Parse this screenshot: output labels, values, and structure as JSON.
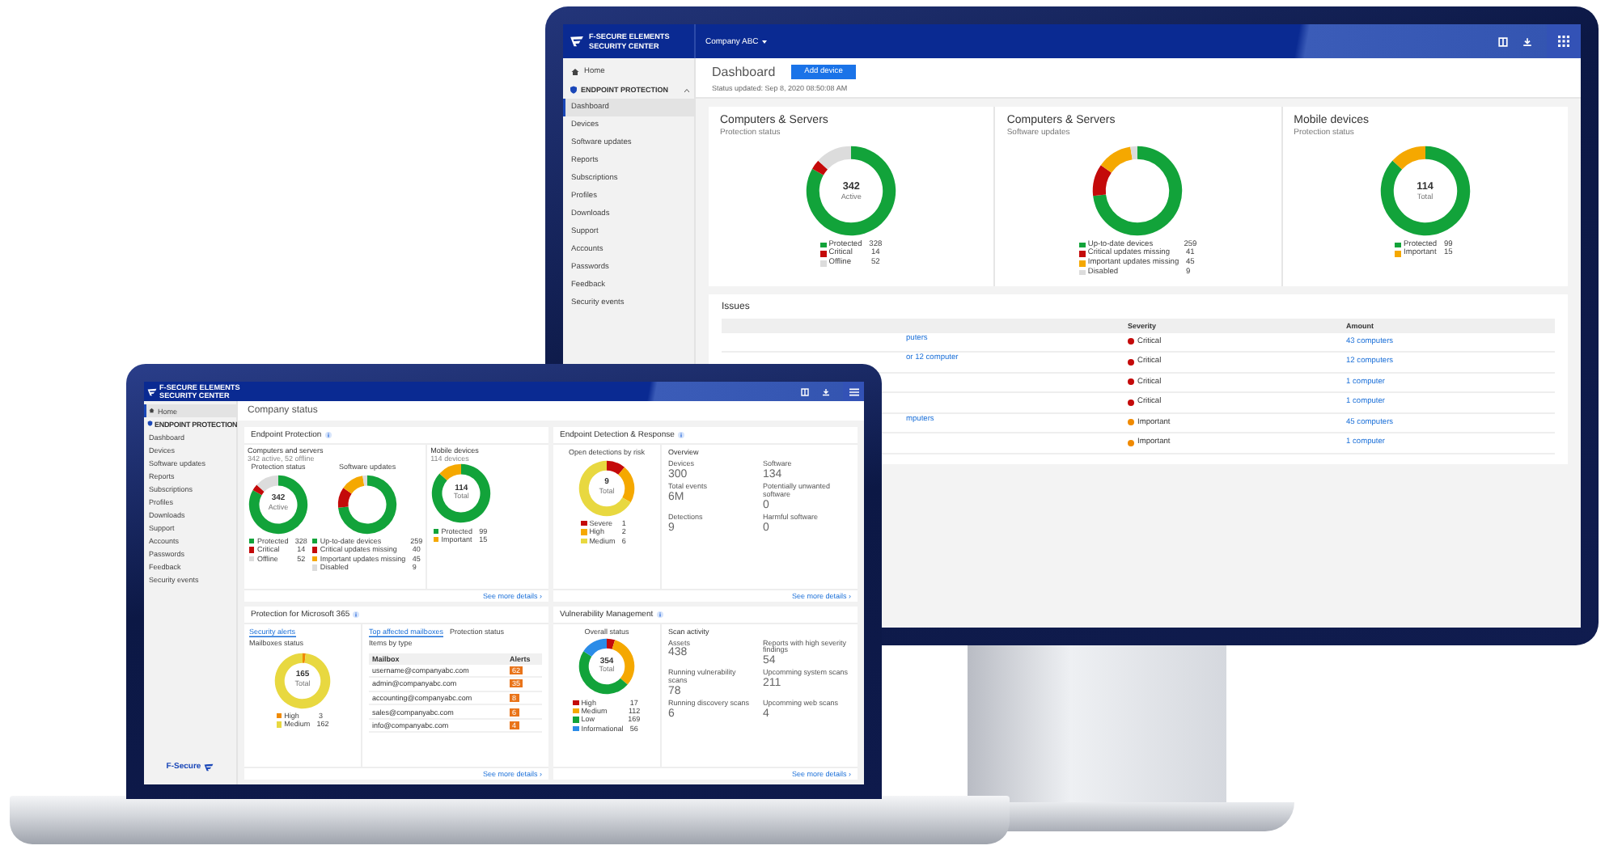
{
  "monitor": {
    "header": {
      "brand_line_1": "F-SECURE ELEMENTS",
      "brand_line_2": "SECURITY CENTER",
      "company": "Company ABC"
    },
    "sidebar": {
      "home": {
        "label": "Home",
        "selected": false
      },
      "section": "ENDPOINT PROTECTION",
      "items": [
        {
          "label": "Dashboard",
          "selected": true
        },
        {
          "label": "Devices",
          "selected": false
        },
        {
          "label": "Software updates",
          "selected": false
        },
        {
          "label": "Reports",
          "selected": false
        },
        {
          "label": "Subscriptions",
          "selected": false
        },
        {
          "label": "Profiles",
          "selected": false
        },
        {
          "label": "Downloads",
          "selected": false
        },
        {
          "label": "Support",
          "selected": false
        },
        {
          "label": "Accounts",
          "selected": false
        },
        {
          "label": "Passwords",
          "selected": false
        },
        {
          "label": "Feedback",
          "selected": false
        },
        {
          "label": "Security events",
          "selected": false
        }
      ]
    },
    "page": {
      "title": "Dashboard",
      "button": "Add device",
      "status": "Status updated: Sep 8, 2020 08:50:08 AM"
    },
    "cards": [
      {
        "title": "Computers & Servers",
        "subtitle": "Protection status",
        "chart": {
          "center_value": "342",
          "center_label": "Active",
          "legend": [
            {
              "color": "#12a33a"
            },
            {
              "color": "#c40a0a"
            },
            {
              "color": "#dcdcdc"
            }
          ],
          "chart_data": {
            "type": "donut",
            "categories": [
              "Protected",
              "Critical",
              "Offline"
            ],
            "values": [
              328,
              14,
              52
            ],
            "value_labels": [
              "328",
              "14",
              "52"
            ],
            "legend": "bottom"
          }
        }
      },
      {
        "title": "Computers & Servers",
        "subtitle": "Software updates",
        "chart": {
          "legend": [
            {
              "color": "#12a33a"
            },
            {
              "color": "#c40a0a"
            },
            {
              "color": "#f5a800"
            },
            {
              "color": "#dcdcdc"
            }
          ],
          "chart_data": {
            "type": "donut",
            "categories": [
              "Up-to-date devices",
              "Critical updates missing",
              "Important updates missing",
              "Disabled"
            ],
            "values": [
              259,
              41,
              45,
              9
            ],
            "value_labels": [
              "259",
              "41",
              "45",
              "9"
            ],
            "legend": "bottom"
          }
        }
      },
      {
        "title": "Mobile devices",
        "subtitle": "Protection status",
        "chart": {
          "center_value": "114",
          "center_label": "Total",
          "legend": [
            {
              "color": "#12a33a"
            },
            {
              "color": "#f5a800"
            }
          ],
          "chart_data": {
            "type": "donut",
            "categories": [
              "Protected",
              "Important"
            ],
            "values": [
              99,
              15
            ],
            "value_labels": [
              "99",
              "15"
            ],
            "legend": "bottom"
          }
        }
      }
    ],
    "issues": {
      "title": "Issues",
      "columns": [
        "Severity",
        "Amount"
      ],
      "rows": [
        {
          "issue": "puters",
          "severity": "Critical",
          "color": "#c40a0a",
          "amount": "43 computers"
        },
        {
          "issue": "or 12 computer",
          "severity": "Critical",
          "color": "#c40a0a",
          "amount": "12 computers"
        },
        {
          "severity": "Critical",
          "color": "#c40a0a",
          "amount": "1 computer"
        },
        {
          "severity": "Critical",
          "color": "#c40a0a",
          "amount": "1 computer"
        },
        {
          "issue": "mputers",
          "severity": "Important",
          "color": "#f08a00",
          "amount": "45 computers"
        },
        {
          "severity": "Important",
          "color": "#f08a00",
          "amount": "1 computer"
        }
      ]
    }
  },
  "laptop": {
    "header": {
      "brand_line_1": "F-SECURE ELEMENTS",
      "brand_line_2": "SECURITY CENTER"
    },
    "sidebar": {
      "home": {
        "label": "Home",
        "selected": true
      },
      "section": "ENDPOINT PROTECTION",
      "items": [
        {
          "label": "Dashboard",
          "selected": false
        },
        {
          "label": "Devices",
          "selected": false
        },
        {
          "label": "Software updates",
          "selected": false
        },
        {
          "label": "Reports",
          "selected": false
        },
        {
          "label": "Subscriptions",
          "selected": false
        },
        {
          "label": "Profiles",
          "selected": false
        },
        {
          "label": "Downloads",
          "selected": false
        },
        {
          "label": "Support",
          "selected": false
        },
        {
          "label": "Accounts",
          "selected": false
        },
        {
          "label": "Passwords",
          "selected": false
        },
        {
          "label": "Feedback",
          "selected": false
        },
        {
          "label": "Security events",
          "selected": false
        }
      ],
      "footer_logo": "F-Secure"
    },
    "title": "Company status",
    "endpoint": {
      "title": "Endpoint Protection",
      "groups": [
        {
          "title": "Computers and servers",
          "subtitle": "342 active, 52 offline",
          "charts": [
            {
              "center_value": "342",
              "center_label": "Active",
              "legend": [
                {
                  "color": "#12a33a"
                },
                {
                  "color": "#c40a0a"
                },
                {
                  "color": "#dcdcdc"
                }
              ],
              "chart_data": {
                "type": "donut",
                "title": "Protection status",
                "categories": [
                  "Protected",
                  "Critical",
                  "Offline"
                ],
                "values": [
                  328,
                  14,
                  52
                ],
                "value_labels": [
                  "328",
                  "14",
                  "52"
                ],
                "legend": "bottom"
              }
            },
            {
              "legend": [
                {
                  "color": "#12a33a"
                },
                {
                  "color": "#c40a0a"
                },
                {
                  "color": "#f5a800"
                },
                {
                  "color": "#dcdcdc"
                }
              ],
              "chart_data": {
                "type": "donut",
                "title": "Software updates",
                "categories": [
                  "Up-to-date devices",
                  "Critical updates missing",
                  "Important updates missing",
                  "Disabled"
                ],
                "values": [
                  259,
                  40,
                  45,
                  9
                ],
                "value_labels": [
                  "259",
                  "40",
                  "45",
                  "9"
                ],
                "legend": "bottom"
              }
            }
          ]
        },
        {
          "title": "Mobile devices",
          "subtitle": "114 devices",
          "charts": [
            {
              "center_value": "114",
              "center_label": "Total",
              "legend": [
                {
                  "color": "#12a33a"
                },
                {
                  "color": "#f5a800"
                }
              ],
              "chart_data": {
                "type": "donut",
                "categories": [
                  "Protected",
                  "Important"
                ],
                "values": [
                  99,
                  15
                ],
                "value_labels": [
                  "99",
                  "15"
                ],
                "legend": "bottom"
              }
            }
          ]
        }
      ],
      "link": "See more details ›"
    },
    "edr": {
      "title": "Endpoint Detection & Response",
      "chart": {
        "center_value": "9",
        "center_label": "Total",
        "legend": [
          {
            "color": "#c40a0a"
          },
          {
            "color": "#f5a800"
          },
          {
            "color": "#e8d840"
          }
        ],
        "chart_data": {
          "type": "donut",
          "title": "Open detections by risk",
          "categories": [
            "Severe",
            "High",
            "Medium"
          ],
          "values": [
            1,
            2,
            6
          ],
          "value_labels": [
            "1",
            "2",
            "6"
          ],
          "legend": "bottom"
        }
      },
      "stats_title": "Overview",
      "stats": [
        {
          "label": "Devices",
          "value": "300"
        },
        {
          "label": "Software",
          "value": "134"
        },
        {
          "label": "Total events",
          "value": "6M"
        },
        {
          "label": "Potentially unwanted software",
          "value": "0"
        },
        {
          "label": "Detections",
          "value": "9"
        },
        {
          "label": "Harmful software",
          "value": "0"
        }
      ],
      "link": "See more details ›"
    },
    "m365": {
      "title": "Protection for Microsoft 365",
      "left_tabs": [
        {
          "label": "Security alerts",
          "selected": true
        },
        {
          "label": "Mailboxes status",
          "selected": false
        }
      ],
      "chart": {
        "center_value": "165",
        "center_label": "Total",
        "legend": [
          {
            "color": "#f08a00"
          },
          {
            "color": "#e8d840"
          }
        ],
        "chart_data": {
          "type": "donut",
          "categories": [
            "High",
            "Medium"
          ],
          "values": [
            3,
            162
          ],
          "value_labels": [
            "3",
            "162"
          ],
          "legend": "bottom"
        }
      },
      "right_tabs": [
        {
          "label": "Top affected mailboxes",
          "selected": true
        },
        {
          "label": "Protection status",
          "selected": false
        },
        {
          "label": "Items by type",
          "selected": false
        }
      ],
      "table": {
        "columns": [
          "Mailbox",
          "Alerts"
        ],
        "rows": [
          {
            "mailbox": "username@companyabc.com",
            "alerts": "62"
          },
          {
            "mailbox": "admin@companyabc.com",
            "alerts": "35"
          },
          {
            "mailbox": "accounting@companyabc.com",
            "alerts": "8"
          },
          {
            "mailbox": "sales@companyabc.com",
            "alerts": "6"
          },
          {
            "mailbox": "info@companyabc.com",
            "alerts": "4"
          }
        ]
      },
      "link": "See more details ›"
    },
    "vm": {
      "title": "Vulnerability Management",
      "chart": {
        "center_value": "354",
        "center_label": "Total",
        "legend": [
          {
            "color": "#c40a0a"
          },
          {
            "color": "#f5a800"
          },
          {
            "color": "#12a33a"
          },
          {
            "color": "#2b8ce8"
          }
        ],
        "chart_data": {
          "type": "donut",
          "title": "Overall status",
          "categories": [
            "High",
            "Medium",
            "Low",
            "Informational"
          ],
          "values": [
            17,
            112,
            169,
            56
          ],
          "value_labels": [
            "17",
            "112",
            "169",
            "56"
          ],
          "legend": "bottom"
        }
      },
      "stats_title": "Scan activity",
      "stats": [
        {
          "label": "Assets",
          "value": "438"
        },
        {
          "label": "Reports with high severity findings",
          "value": "54"
        },
        {
          "label": "Running vulnerability scans",
          "value": "78"
        },
        {
          "label": "Upcomming system scans",
          "value": "211"
        },
        {
          "label": "Running discovery scans",
          "value": "6"
        },
        {
          "label": "Upcomming web scans",
          "value": "4"
        }
      ],
      "link": "See more details ›"
    }
  }
}
